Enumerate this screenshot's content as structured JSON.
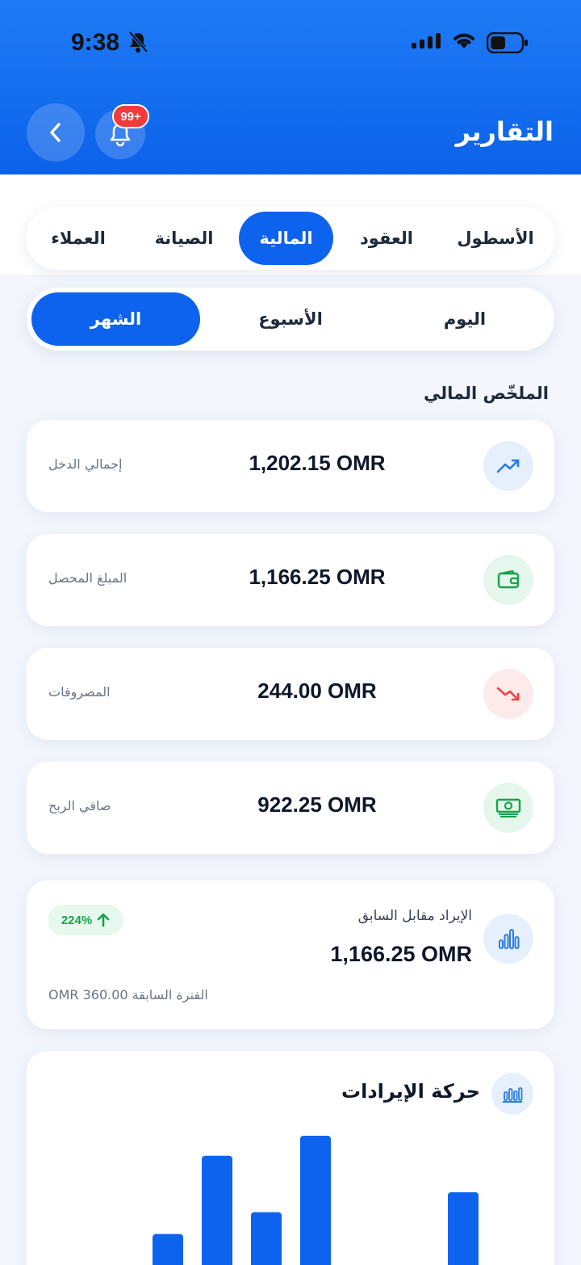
{
  "status_bar": {
    "time": "9:38"
  },
  "header": {
    "title": "التقارير",
    "notification_badge": "99+"
  },
  "tabs": [
    {
      "label": "الأسطول",
      "active": false
    },
    {
      "label": "العقود",
      "active": false
    },
    {
      "label": "المالية",
      "active": true
    },
    {
      "label": "الصيانة",
      "active": false
    },
    {
      "label": "العملاء",
      "active": false
    }
  ],
  "periods": [
    {
      "label": "اليوم",
      "active": false
    },
    {
      "label": "الأسبوع",
      "active": false
    },
    {
      "label": "الشهر",
      "active": true
    }
  ],
  "summary": {
    "title": "الملخّص المالي",
    "cards": [
      {
        "label": "إجمالي الدخل",
        "value": "1,202.15 OMR",
        "icon": "trending-up-icon",
        "color": "#2a7be8",
        "bg": "#e6f0fd"
      },
      {
        "label": "المبلغ المحصل",
        "value": "1,166.25 OMR",
        "icon": "wallet-icon",
        "color": "#16a34a",
        "bg": "#e5f7ec"
      },
      {
        "label": "المصروفات",
        "value": "244.00 OMR",
        "icon": "trending-down-icon",
        "color": "#ef4444",
        "bg": "#fdeaea"
      },
      {
        "label": "صافي الربح",
        "value": "922.25 OMR",
        "icon": "cash-icon",
        "color": "#16a34a",
        "bg": "#e5f7ec"
      }
    ]
  },
  "comparison": {
    "title": "الإيراد مقابل السابق",
    "value": "1,166.25 OMR",
    "change": "224%",
    "previous": "الفترة السابقة 360.00 OMR",
    "icon": "bar-chart-icon"
  },
  "revenue_chart": {
    "title": "حركة الإيرادات",
    "icon": "bar-chart-icon"
  },
  "chart_data": {
    "type": "bar",
    "title": "حركة الإيرادات",
    "categories": [],
    "values": [
      8,
      2,
      42,
      128,
      66,
      150,
      4,
      1,
      88
    ],
    "relative": true
  }
}
